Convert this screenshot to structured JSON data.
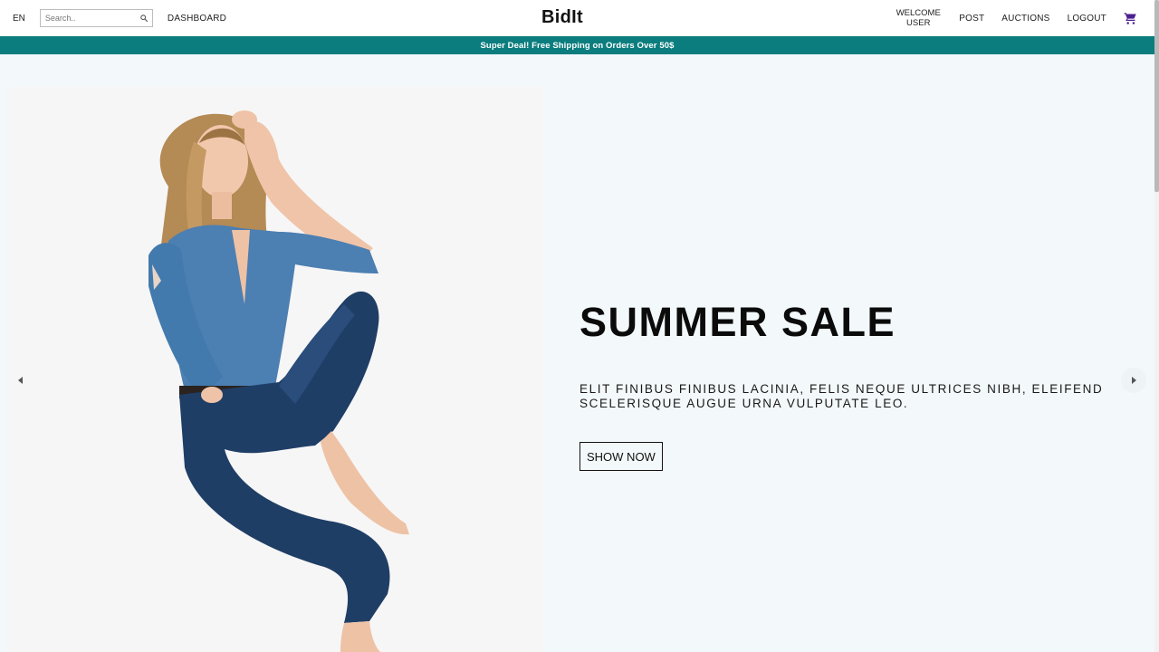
{
  "header": {
    "language": "EN",
    "search": {
      "placeholder": "Search..",
      "value": "",
      "icon": "search-icon"
    },
    "dashboard_label": "DASHBOARD",
    "logo": "BidIt",
    "welcome_line1": "WELCOME",
    "welcome_line2": "USER",
    "links": {
      "post": "POST",
      "auctions": "AUCTIONS",
      "logout": "LOGOUT"
    },
    "cart_icon": "shopping-cart-icon",
    "cart_color": "#4b1f8f"
  },
  "promo": {
    "text": "Super Deal! Free Shipping on Orders Over 50$",
    "background": "#0c7d7e"
  },
  "slider": {
    "title": "SUMMER SALE",
    "description": "Elit finibus finibus lacinia, felis neque ultrices nibh, eleifend scelerisque augue urna vulputate leo.",
    "button_label": "SHOW NOW",
    "prev_icon": "arrow-left-icon",
    "next_icon": "arrow-right-icon",
    "image": "model-photo",
    "background": "#f3f8fa"
  }
}
